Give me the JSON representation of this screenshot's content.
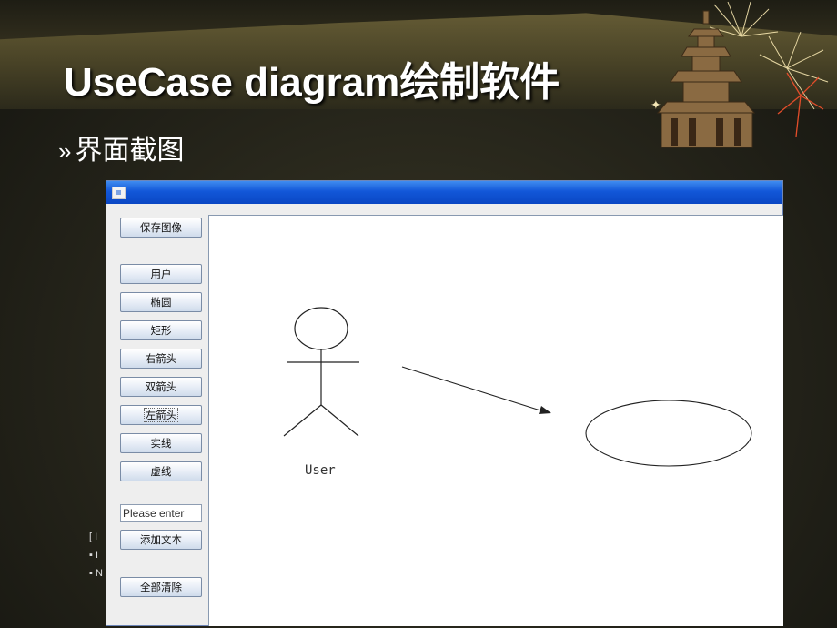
{
  "slide": {
    "title": "UseCase diagram绘制软件",
    "bullet_mark": "»",
    "bullet_text": "界面截图",
    "notes": [
      "[ I",
      "▪ I",
      "▪ N"
    ]
  },
  "window": {
    "buttons": {
      "save_image": "保存图像",
      "user": "用户",
      "ellipse": "椭圆",
      "rectangle": "矩形",
      "right_arrow": "右箭头",
      "double_arrow": "双箭头",
      "left_arrow": "左箭头",
      "solid_line": "实线",
      "dashed_line": "虚线",
      "add_text": "添加文本",
      "clear_all": "全部清除"
    },
    "text_input": {
      "value": "Please enter"
    }
  },
  "canvas": {
    "actor_label": "User"
  },
  "colors": {
    "titlebar": "#1257d8",
    "canvas_bg": "#ffffff"
  }
}
